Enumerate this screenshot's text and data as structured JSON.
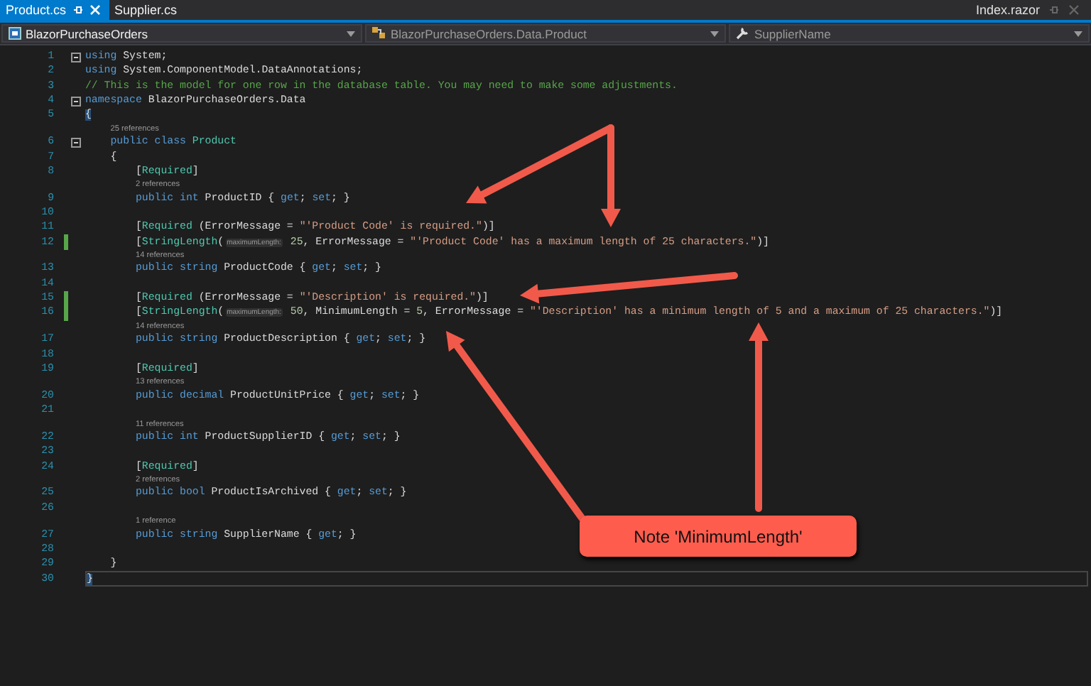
{
  "tabs": [
    {
      "label": "Product.cs",
      "selected": true
    },
    {
      "label": "Supplier.cs",
      "selected": false
    }
  ],
  "preview_tab": {
    "label": "Index.razor"
  },
  "nav_bar": [
    {
      "kind": "project",
      "label": "BlazorPurchaseOrders"
    },
    {
      "kind": "class",
      "label": "BlazorPurchaseOrders.Data.Product"
    },
    {
      "kind": "member",
      "label": "SupplierName"
    }
  ],
  "code_lines": [
    {
      "n": "1",
      "fold": true,
      "tokens": [
        {
          "kind": "kw",
          "text": "using"
        },
        {
          "kind": "plain",
          "text": " System;"
        }
      ]
    },
    {
      "n": "2",
      "tokens": [
        {
          "kind": "kw",
          "text": "using"
        },
        {
          "kind": "plain",
          "text": " System.ComponentModel.DataAnnotations;"
        }
      ]
    },
    {
      "n": "3",
      "tokens": [
        {
          "kind": "comment",
          "text": "// This is the model for one row in the database table. You may need to make some adjustments."
        }
      ]
    },
    {
      "n": "4",
      "fold": true,
      "tokens": [
        {
          "kind": "kw",
          "text": "namespace"
        },
        {
          "kind": "plain",
          "text": " BlazorPurchaseOrders.Data"
        }
      ]
    },
    {
      "n": "5",
      "tokens": [
        {
          "kind": "brace",
          "text": "{"
        }
      ]
    },
    {
      "n": "6",
      "fold": true,
      "references": "25 references",
      "tokens": [
        {
          "kind": "kw",
          "text": "    public class "
        },
        {
          "kind": "type",
          "text": "Product"
        }
      ]
    },
    {
      "n": "7",
      "tokens": [
        {
          "kind": "plain",
          "text": "    {"
        }
      ]
    },
    {
      "n": "8",
      "tokens": [
        {
          "kind": "plain",
          "text": "        ["
        },
        {
          "kind": "type",
          "text": "Required"
        },
        {
          "kind": "plain",
          "text": "]"
        }
      ]
    },
    {
      "n": "9",
      "references": "2 references",
      "tokens": [
        {
          "kind": "kw",
          "text": "        public int"
        },
        {
          "kind": "plain",
          "text": " ProductID { "
        },
        {
          "kind": "kw",
          "text": "get"
        },
        {
          "kind": "plain",
          "text": "; "
        },
        {
          "kind": "kw",
          "text": "set"
        },
        {
          "kind": "plain",
          "text": "; }"
        }
      ]
    },
    {
      "n": "10"
    },
    {
      "n": "11",
      "tokens": [
        {
          "kind": "plain",
          "text": "        ["
        },
        {
          "kind": "type",
          "text": "Required"
        },
        {
          "kind": "plain",
          "text": " (ErrorMessage = "
        },
        {
          "kind": "str",
          "text": "\"'Product Code' is required.\""
        },
        {
          "kind": "plain",
          "text": ")]"
        }
      ]
    },
    {
      "n": "12",
      "modified": true,
      "tokens": [
        {
          "kind": "plain",
          "text": "        ["
        },
        {
          "kind": "type",
          "text": "StringLength"
        },
        {
          "kind": "plain",
          "text": "("
        },
        {
          "kind": "hint",
          "text": "maximumLength:"
        },
        {
          "kind": "num",
          "text": " 25"
        },
        {
          "kind": "plain",
          "text": ", ErrorMessage = "
        },
        {
          "kind": "str",
          "text": "\"'Product Code' has a maximum length of 25 characters.\""
        },
        {
          "kind": "plain",
          "text": ")]"
        }
      ]
    },
    {
      "n": "13",
      "references": "14 references",
      "tokens": [
        {
          "kind": "kw",
          "text": "        public string"
        },
        {
          "kind": "plain",
          "text": " ProductCode { "
        },
        {
          "kind": "kw",
          "text": "get"
        },
        {
          "kind": "plain",
          "text": "; "
        },
        {
          "kind": "kw",
          "text": "set"
        },
        {
          "kind": "plain",
          "text": "; }"
        }
      ]
    },
    {
      "n": "14"
    },
    {
      "n": "15",
      "modified": true,
      "tokens": [
        {
          "kind": "plain",
          "text": "        ["
        },
        {
          "kind": "type",
          "text": "Required"
        },
        {
          "kind": "plain",
          "text": " (ErrorMessage = "
        },
        {
          "kind": "str",
          "text": "\"'Description' is required.\""
        },
        {
          "kind": "plain",
          "text": ")]"
        }
      ]
    },
    {
      "n": "16",
      "modified": true,
      "tokens": [
        {
          "kind": "plain",
          "text": "        ["
        },
        {
          "kind": "type",
          "text": "StringLength"
        },
        {
          "kind": "plain",
          "text": "("
        },
        {
          "kind": "hint",
          "text": "maximumLength:"
        },
        {
          "kind": "num",
          "text": " 50"
        },
        {
          "kind": "plain",
          "text": ", MinimumLength = "
        },
        {
          "kind": "num",
          "text": "5"
        },
        {
          "kind": "plain",
          "text": ", ErrorMessage = "
        },
        {
          "kind": "str",
          "text": "\"'Description' has a minimum length of 5 and a maximum of 25 characters.\""
        },
        {
          "kind": "plain",
          "text": ")]"
        }
      ]
    },
    {
      "n": "17",
      "references": "14 references",
      "tokens": [
        {
          "kind": "kw",
          "text": "        public string"
        },
        {
          "kind": "plain",
          "text": " ProductDescription { "
        },
        {
          "kind": "kw",
          "text": "get"
        },
        {
          "kind": "plain",
          "text": "; "
        },
        {
          "kind": "kw",
          "text": "set"
        },
        {
          "kind": "plain",
          "text": "; }"
        }
      ]
    },
    {
      "n": "18"
    },
    {
      "n": "19",
      "tokens": [
        {
          "kind": "plain",
          "text": "        ["
        },
        {
          "kind": "type",
          "text": "Required"
        },
        {
          "kind": "plain",
          "text": "]"
        }
      ]
    },
    {
      "n": "20",
      "references": "13 references",
      "tokens": [
        {
          "kind": "kw",
          "text": "        public decimal"
        },
        {
          "kind": "plain",
          "text": " ProductUnitPrice { "
        },
        {
          "kind": "kw",
          "text": "get"
        },
        {
          "kind": "plain",
          "text": "; "
        },
        {
          "kind": "kw",
          "text": "set"
        },
        {
          "kind": "plain",
          "text": "; }"
        }
      ]
    },
    {
      "n": "21"
    },
    {
      "n": "22",
      "references": "11 references",
      "tokens": [
        {
          "kind": "kw",
          "text": "        public int"
        },
        {
          "kind": "plain",
          "text": " ProductSupplierID { "
        },
        {
          "kind": "kw",
          "text": "get"
        },
        {
          "kind": "plain",
          "text": "; "
        },
        {
          "kind": "kw",
          "text": "set"
        },
        {
          "kind": "plain",
          "text": "; }"
        }
      ]
    },
    {
      "n": "23"
    },
    {
      "n": "24",
      "tokens": [
        {
          "kind": "plain",
          "text": "        ["
        },
        {
          "kind": "type",
          "text": "Required"
        },
        {
          "kind": "plain",
          "text": "]"
        }
      ]
    },
    {
      "n": "25",
      "references": "2 references",
      "tokens": [
        {
          "kind": "kw",
          "text": "        public bool"
        },
        {
          "kind": "plain",
          "text": " ProductIsArchived { "
        },
        {
          "kind": "kw",
          "text": "get"
        },
        {
          "kind": "plain",
          "text": "; "
        },
        {
          "kind": "kw",
          "text": "set"
        },
        {
          "kind": "plain",
          "text": "; }"
        }
      ]
    },
    {
      "n": "26"
    },
    {
      "n": "27",
      "references": "1 reference",
      "tokens": [
        {
          "kind": "kw",
          "text": "        public string"
        },
        {
          "kind": "plain",
          "text": " SupplierName { "
        },
        {
          "kind": "kw",
          "text": "get"
        },
        {
          "kind": "plain",
          "text": "; }"
        }
      ]
    },
    {
      "n": "28"
    },
    {
      "n": "29",
      "tokens": [
        {
          "kind": "plain",
          "text": "    }"
        }
      ]
    },
    {
      "n": "30",
      "current": true,
      "tokens": [
        {
          "kind": "brace",
          "text": "}"
        }
      ]
    }
  ],
  "callout": {
    "text": "Note 'MinimumLength'"
  }
}
